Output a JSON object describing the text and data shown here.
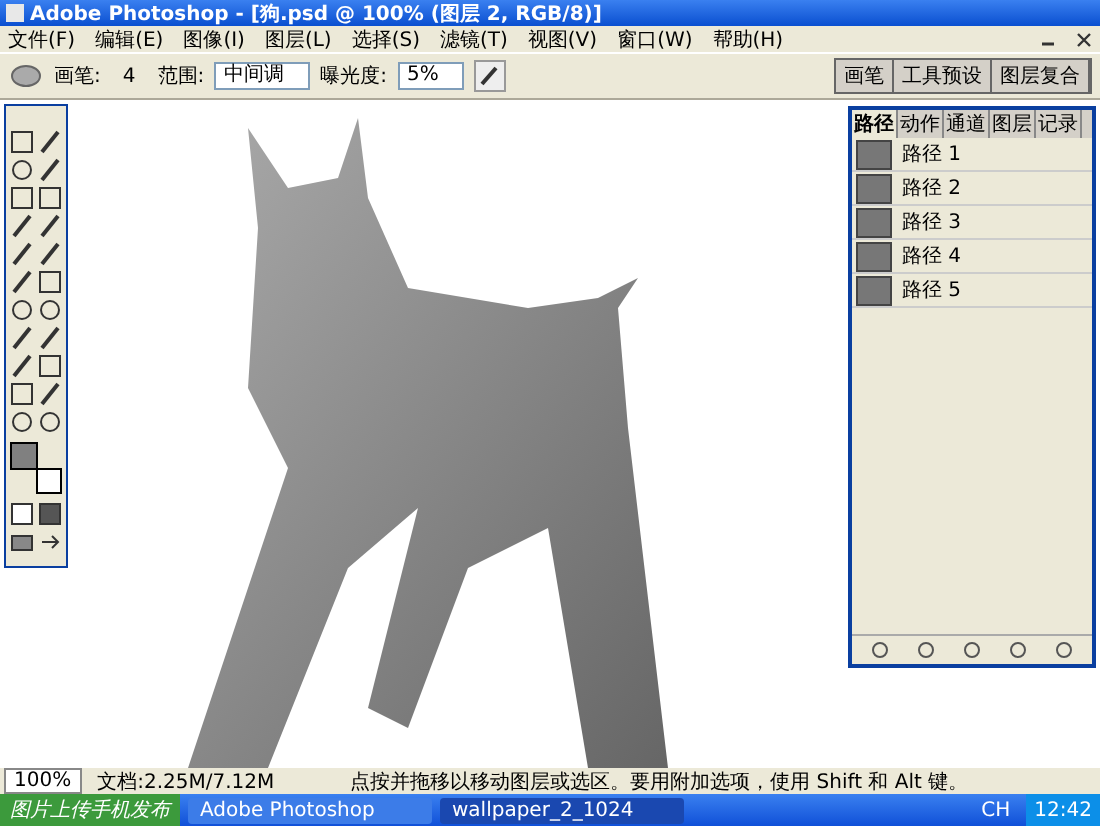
{
  "window": {
    "title": "Adobe Photoshop - [狗.psd @ 100% (图层 2, RGB/8)]"
  },
  "menu": [
    "文件(F)",
    "编辑(E)",
    "图像(I)",
    "图层(L)",
    "选择(S)",
    "滤镜(T)",
    "视图(V)",
    "窗口(W)",
    "帮助(H)"
  ],
  "options": {
    "brush_label": "画笔:",
    "brush_size": "4",
    "range_label": "范围:",
    "range_value": "中间调",
    "exposure_label": "曝光度:",
    "exposure_value": "5%"
  },
  "dock_tabs": [
    "画笔",
    "工具预设",
    "图层复合"
  ],
  "tools": [
    {
      "kind": "marquee"
    },
    {
      "kind": "move"
    },
    {
      "kind": "lasso"
    },
    {
      "kind": "wand"
    },
    {
      "kind": "crop"
    },
    {
      "kind": "slice"
    },
    {
      "kind": "heal"
    },
    {
      "kind": "brush"
    },
    {
      "kind": "stamp"
    },
    {
      "kind": "history"
    },
    {
      "kind": "eraser"
    },
    {
      "kind": "gradient"
    },
    {
      "kind": "blur"
    },
    {
      "kind": "dodge"
    },
    {
      "kind": "path"
    },
    {
      "kind": "type"
    },
    {
      "kind": "direct"
    },
    {
      "kind": "shape"
    },
    {
      "kind": "notes"
    },
    {
      "kind": "eyedropper"
    },
    {
      "kind": "hand"
    },
    {
      "kind": "zoom"
    }
  ],
  "panel": {
    "tabs": [
      {
        "label": "路径",
        "selected": true
      },
      {
        "label": "动作",
        "selected": false
      },
      {
        "label": "通道",
        "selected": false
      },
      {
        "label": "图层",
        "selected": false
      },
      {
        "label": "记录",
        "selected": false
      }
    ],
    "paths": [
      {
        "name": "路径 1",
        "selected": false
      },
      {
        "name": "路径 2",
        "selected": false
      },
      {
        "name": "路径 3",
        "selected": false
      },
      {
        "name": "路径 4",
        "selected": false
      },
      {
        "name": "路径 5",
        "selected": false
      }
    ]
  },
  "status_bar": {
    "zoom": "100%",
    "doc": "文档:2.25M/7.12M",
    "hint": "点按并拖移以移动图层或选区。要用附加选项，使用 Shift 和 Alt 键。"
  },
  "taskbar": {
    "start": "图片上传手机发布",
    "items": [
      {
        "label": "Adobe Photoshop",
        "selected": false
      },
      {
        "label": "wallpaper_2_1024",
        "selected": true
      }
    ],
    "lang": "CH",
    "clock": "12:42"
  }
}
